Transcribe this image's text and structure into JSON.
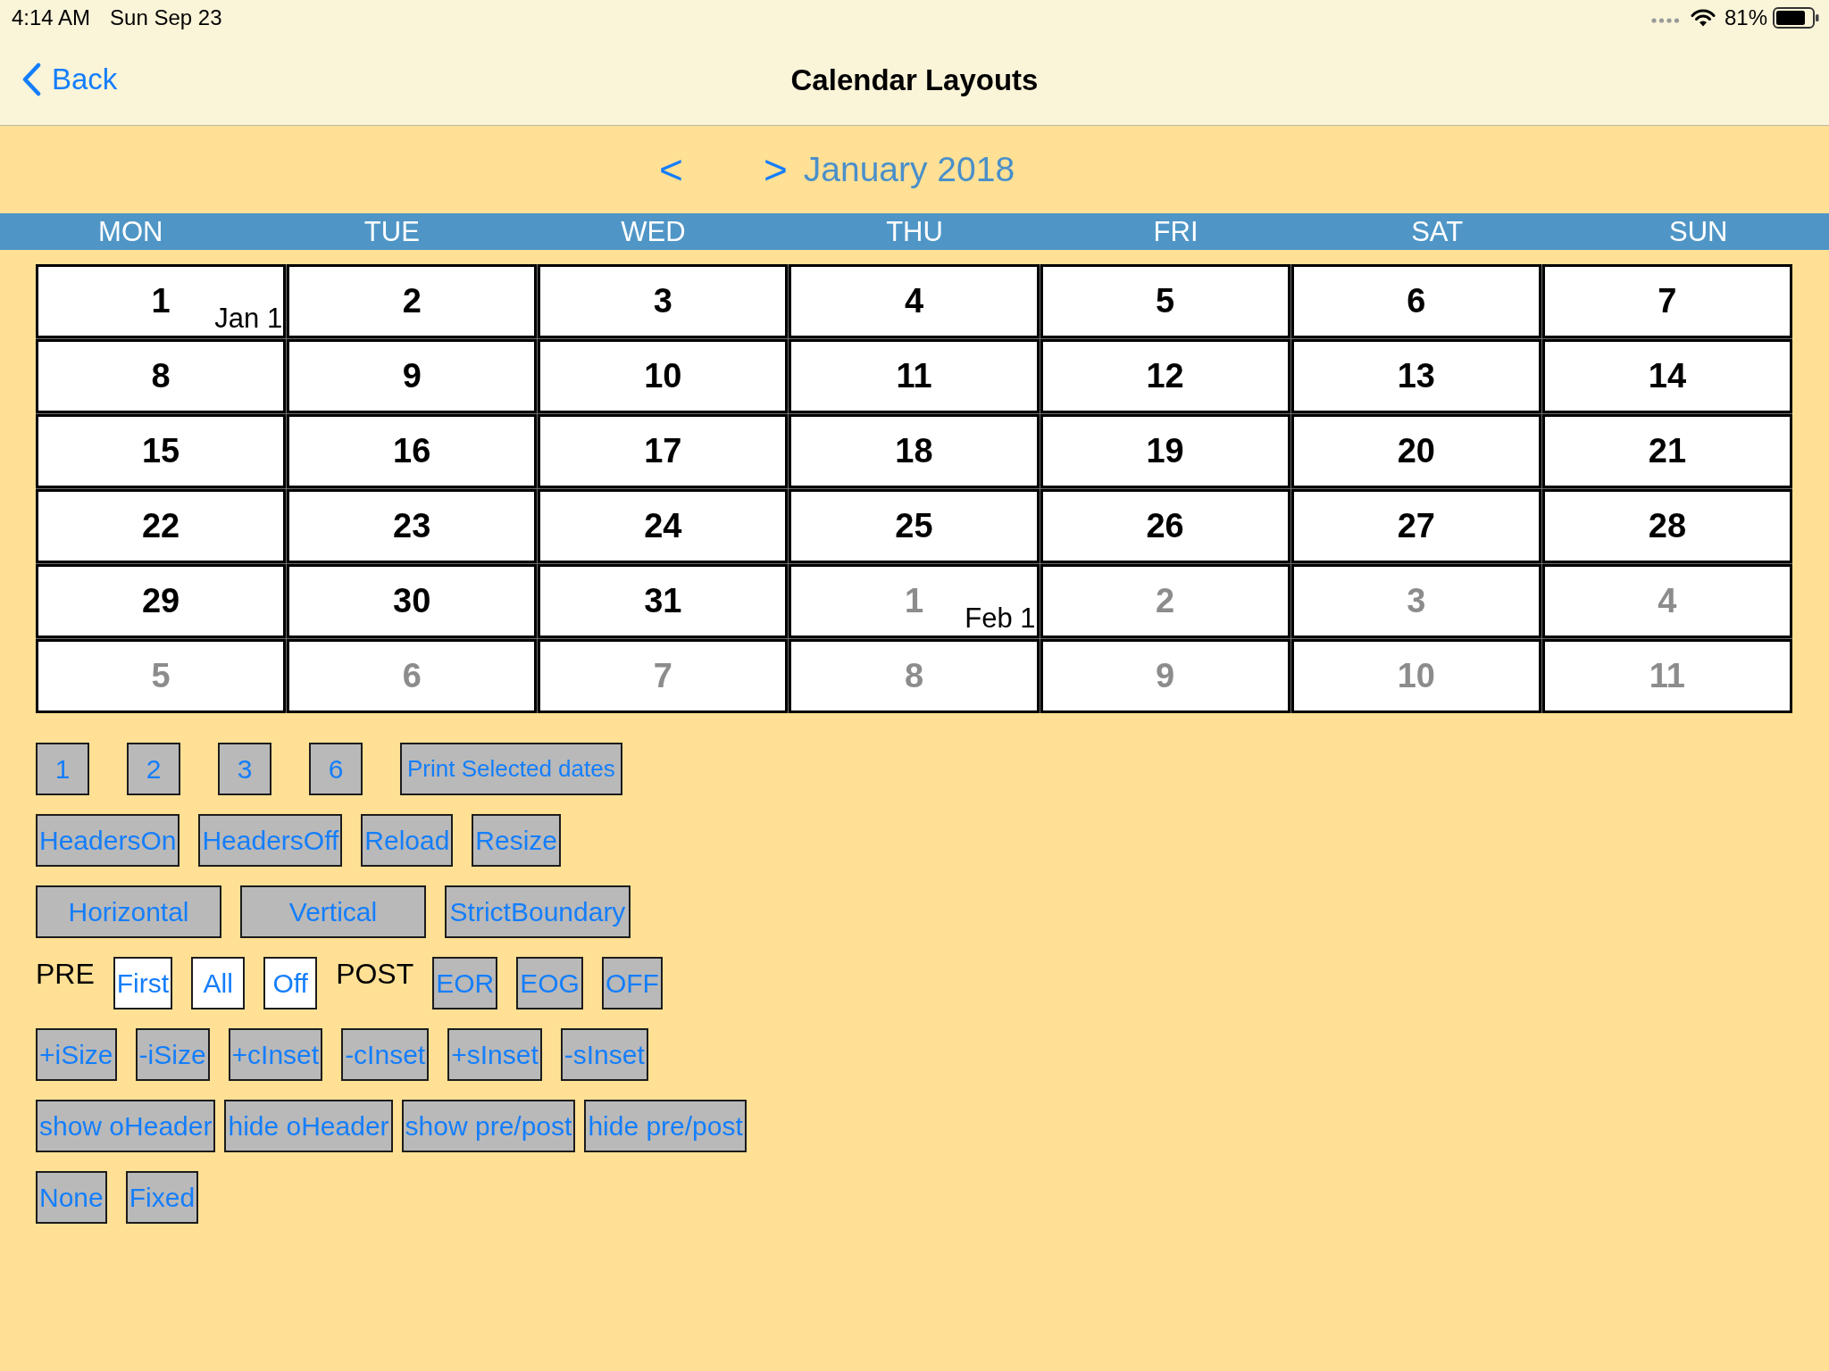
{
  "status_bar": {
    "time": "4:14 AM",
    "date": "Sun Sep 23",
    "battery": "81%"
  },
  "nav_bar": {
    "back": "Back",
    "title": "Calendar Layouts"
  },
  "calendar": {
    "prev": "<",
    "next": ">",
    "month": "January 2018",
    "weekdays": [
      "MON",
      "TUE",
      "WED",
      "THU",
      "FRI",
      "SAT",
      "SUN"
    ],
    "weeks": [
      [
        {
          "day": "1",
          "dimmed": false,
          "note": "Jan 1"
        },
        {
          "day": "2",
          "dimmed": false
        },
        {
          "day": "3",
          "dimmed": false
        },
        {
          "day": "4",
          "dimmed": false
        },
        {
          "day": "5",
          "dimmed": false
        },
        {
          "day": "6",
          "dimmed": false
        },
        {
          "day": "7",
          "dimmed": false
        }
      ],
      [
        {
          "day": "8",
          "dimmed": false
        },
        {
          "day": "9",
          "dimmed": false
        },
        {
          "day": "10",
          "dimmed": false
        },
        {
          "day": "11",
          "dimmed": false
        },
        {
          "day": "12",
          "dimmed": false
        },
        {
          "day": "13",
          "dimmed": false
        },
        {
          "day": "14",
          "dimmed": false
        }
      ],
      [
        {
          "day": "15",
          "dimmed": false
        },
        {
          "day": "16",
          "dimmed": false
        },
        {
          "day": "17",
          "dimmed": false
        },
        {
          "day": "18",
          "dimmed": false
        },
        {
          "day": "19",
          "dimmed": false
        },
        {
          "day": "20",
          "dimmed": false
        },
        {
          "day": "21",
          "dimmed": false
        }
      ],
      [
        {
          "day": "22",
          "dimmed": false
        },
        {
          "day": "23",
          "dimmed": false
        },
        {
          "day": "24",
          "dimmed": false
        },
        {
          "day": "25",
          "dimmed": false
        },
        {
          "day": "26",
          "dimmed": false
        },
        {
          "day": "27",
          "dimmed": false
        },
        {
          "day": "28",
          "dimmed": false
        }
      ],
      [
        {
          "day": "29",
          "dimmed": false
        },
        {
          "day": "30",
          "dimmed": false
        },
        {
          "day": "31",
          "dimmed": false
        },
        {
          "day": "1",
          "dimmed": true,
          "note": "Feb 1"
        },
        {
          "day": "2",
          "dimmed": true
        },
        {
          "day": "3",
          "dimmed": true
        },
        {
          "day": "4",
          "dimmed": true
        }
      ],
      [
        {
          "day": "5",
          "dimmed": true
        },
        {
          "day": "6",
          "dimmed": true
        },
        {
          "day": "7",
          "dimmed": true
        },
        {
          "day": "8",
          "dimmed": true
        },
        {
          "day": "9",
          "dimmed": true
        },
        {
          "day": "10",
          "dimmed": true
        },
        {
          "day": "11",
          "dimmed": true
        }
      ]
    ]
  },
  "button_rows": [
    [
      {
        "kind": "button",
        "label": "1"
      },
      {
        "kind": "button",
        "label": "2"
      },
      {
        "kind": "button",
        "label": "3"
      },
      {
        "kind": "button",
        "label": "6"
      },
      {
        "kind": "button",
        "label": "Print Selected dates"
      }
    ],
    [
      {
        "kind": "button",
        "label": "HeadersOn"
      },
      {
        "kind": "button",
        "label": "HeadersOff"
      },
      {
        "kind": "button",
        "label": "Reload"
      },
      {
        "kind": "button",
        "label": "Resize"
      }
    ],
    [
      {
        "kind": "button",
        "label": "Horizontal"
      },
      {
        "kind": "button",
        "label": "Vertical"
      },
      {
        "kind": "button",
        "label": "StrictBoundary"
      }
    ],
    [
      {
        "kind": "label",
        "label": "PRE"
      },
      {
        "kind": "option",
        "label": "First"
      },
      {
        "kind": "option",
        "label": "All"
      },
      {
        "kind": "option",
        "label": "Off"
      },
      {
        "kind": "label",
        "label": "POST"
      },
      {
        "kind": "button",
        "label": "EOR"
      },
      {
        "kind": "button",
        "label": "EOG"
      },
      {
        "kind": "button",
        "label": "OFF"
      }
    ],
    [
      {
        "kind": "button",
        "label": "+iSize"
      },
      {
        "kind": "button",
        "label": "-iSize"
      },
      {
        "kind": "button",
        "label": "+cInset"
      },
      {
        "kind": "button",
        "label": "-cInset"
      },
      {
        "kind": "button",
        "label": "+sInset"
      },
      {
        "kind": "button",
        "label": "-sInset"
      }
    ],
    [
      {
        "kind": "button",
        "label": "show oHeader"
      },
      {
        "kind": "button",
        "label": "hide oHeader"
      },
      {
        "kind": "button",
        "label": "show pre/post"
      },
      {
        "kind": "button",
        "label": "hide pre/post"
      }
    ],
    [
      {
        "kind": "button",
        "label": "None"
      },
      {
        "kind": "button",
        "label": "Fixed"
      }
    ]
  ]
}
